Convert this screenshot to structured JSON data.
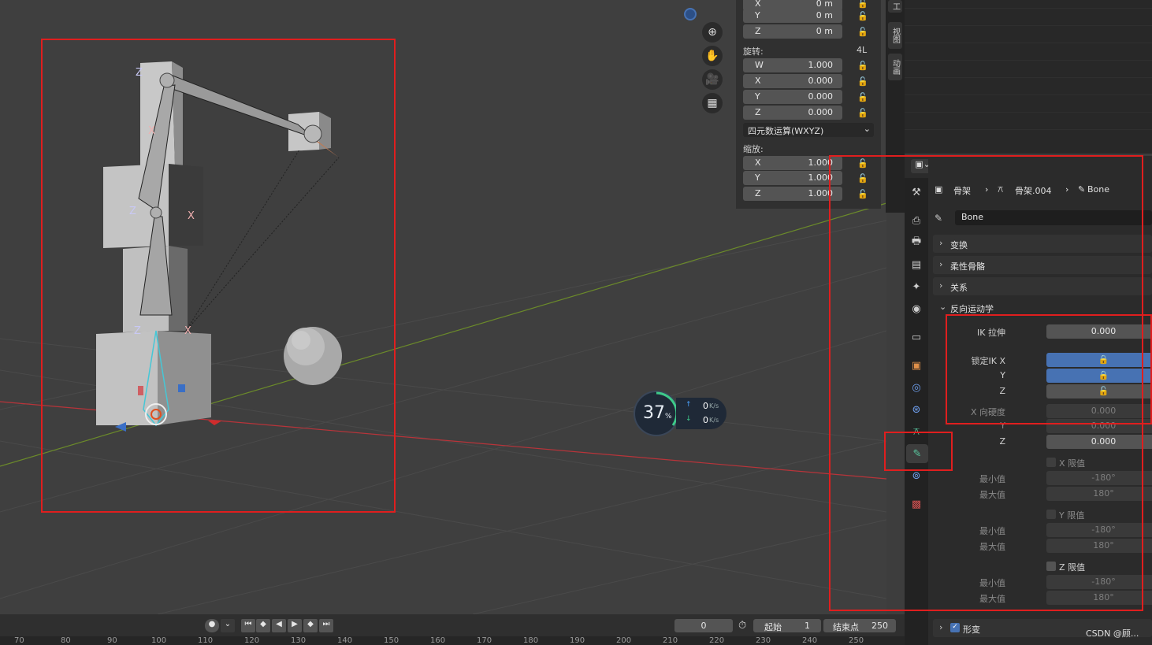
{
  "npanel": {
    "location_rows": [
      {
        "axis": "X",
        "value": "0 m"
      },
      {
        "axis": "Y",
        "value": "0 m"
      },
      {
        "axis": "Z",
        "value": "0 m"
      }
    ],
    "rotation_label": "旋转:",
    "rotation_mode_badge": "4L",
    "rotation_rows": [
      {
        "axis": "W",
        "value": "1.000"
      },
      {
        "axis": "X",
        "value": "0.000"
      },
      {
        "axis": "Y",
        "value": "0.000"
      },
      {
        "axis": "Z",
        "value": "0.000"
      }
    ],
    "rotation_mode_select": "四元数运算(WXYZ)",
    "scale_label": "缩放:",
    "scale_rows": [
      {
        "axis": "X",
        "value": "1.000"
      },
      {
        "axis": "Y",
        "value": "1.000"
      },
      {
        "axis": "Z",
        "value": "1.000"
      }
    ]
  },
  "vtabs": [
    "工",
    "视图",
    "动画"
  ],
  "props": {
    "breadcrumb": [
      "骨架",
      "骨架.004",
      "Bone"
    ],
    "bone_name": "Bone",
    "panels": {
      "transform": "变换",
      "bbone": "柔性骨骼",
      "relations": "关系",
      "ik": "反向运动学"
    },
    "ik": {
      "stretch_label": "IK 拉伸",
      "stretch_value": "0.000",
      "lock_label": "锁定IK X",
      "lock_y_label": "Y",
      "lock_z_label": "Z",
      "stiff_label": "X 向硬度",
      "stiff_x": "0.000",
      "stiff_y_label": "Y",
      "stiff_y": "0.000",
      "stiff_z_label": "Z",
      "stiff_z": "0.000",
      "limit_x_label": "X 限值",
      "limit_y_label": "Y 限值",
      "limit_z_label": "Z 限值",
      "min_label": "最小值",
      "max_label": "最大值",
      "min_value": "-180°",
      "max_value": "180°"
    },
    "deform_panel": "形变"
  },
  "timeline": {
    "current_frame": "0",
    "start_label": "起始",
    "start_value": "1",
    "end_label": "结束点",
    "end_value": "250",
    "ruler_ticks": [
      "70",
      "80",
      "90",
      "100",
      "110",
      "120",
      "130",
      "140",
      "150",
      "160",
      "170",
      "180",
      "190",
      "200",
      "210",
      "220",
      "230",
      "240",
      "250"
    ]
  },
  "speed_widget": {
    "percent": "37",
    "percent_unit": "%",
    "up_rate": "0",
    "down_rate": "0",
    "rate_unit": "K/s"
  },
  "watermark": "CSDN @顾..."
}
